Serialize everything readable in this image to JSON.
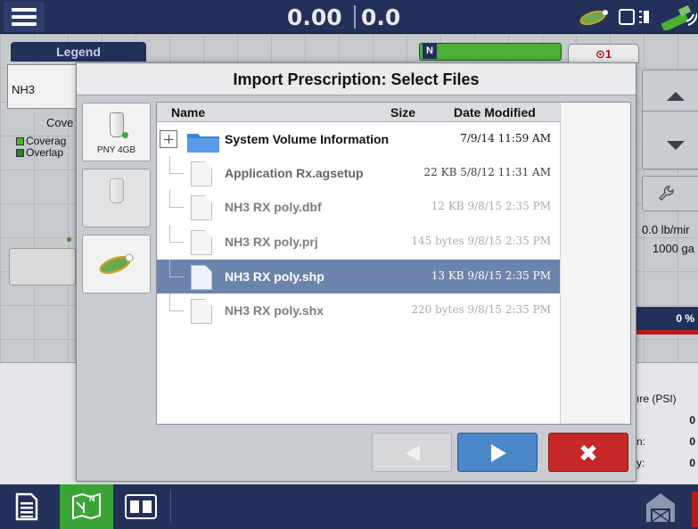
{
  "topbar": {
    "value_left": "0.00",
    "value_right": "0.0",
    "menu_icon": "hamburger-menu-icon",
    "status_icons": [
      "implement-logo-icon",
      "display-box-icon",
      "signal-icon",
      "gps-icon"
    ]
  },
  "background": {
    "legend_tab": "Legend",
    "product": "NH3",
    "coverage_heading": "Cove",
    "legend_items": [
      {
        "label": "Coverag",
        "color": "#4caf36"
      },
      {
        "label": "Overlap",
        "color": "#2e7d32"
      }
    ],
    "marker_label": "N",
    "alert_label": "⊙1",
    "rate_line_1": "0.0 lb/mir",
    "rate_line_2": "1000 ga",
    "progress_label": "0 %",
    "pressure_label": "ıre (PSI)",
    "pressure_rows": [
      {
        "label": "",
        "value": "0"
      },
      {
        "label": "n:",
        "value": "0"
      },
      {
        "label": "y:",
        "value": "0"
      }
    ]
  },
  "dialog": {
    "title": "Import Prescription: Select Files",
    "sources": [
      {
        "label": "PNY 4GB",
        "icon": "usb-drive-icon",
        "active": true
      },
      {
        "label": "",
        "icon": "usb-drive-icon",
        "active": false
      },
      {
        "label": "",
        "icon": "implement-logo-icon",
        "active": false
      }
    ],
    "columns": {
      "name": "Name",
      "size": "Size",
      "date": "Date Modified"
    },
    "files": [
      {
        "name": "System Volume Information",
        "meta": "7/9/14 11:59 AM",
        "type": "folder",
        "state": "active"
      },
      {
        "name": "Application Rx.agsetup",
        "meta": "22 KB 5/8/12 11:31 AM",
        "type": "file",
        "state": "mid"
      },
      {
        "name": "NH3 RX poly.dbf",
        "meta": "12 KB 9/8/15 2:35 PM",
        "type": "file",
        "state": "dimmed"
      },
      {
        "name": "NH3 RX poly.prj",
        "meta": "145 bytes 9/8/15 2:35 PM",
        "type": "file",
        "state": "dimmed"
      },
      {
        "name": "NH3 RX poly.shp",
        "meta": "13 KB 9/8/15 2:35 PM",
        "type": "file",
        "state": "selected"
      },
      {
        "name": "NH3 RX poly.shx",
        "meta": "220 bytes 9/8/15 2:35 PM",
        "type": "file",
        "state": "dimmed"
      }
    ],
    "buttons": {
      "prev_icon": "arrow-left-icon",
      "next_icon": "arrow-right-icon",
      "cancel_glyph": "✖"
    }
  },
  "bottombar": {
    "buttons": [
      "summary-report-icon",
      "mapping-icon",
      "split-screen-icon"
    ],
    "right_icon": "barn-icon"
  },
  "colors": {
    "navy": "#23305a",
    "selection": "#6c84ac",
    "next_blue": "#4a86c8",
    "cancel_red": "#c62828",
    "active_green": "#3aa435"
  }
}
